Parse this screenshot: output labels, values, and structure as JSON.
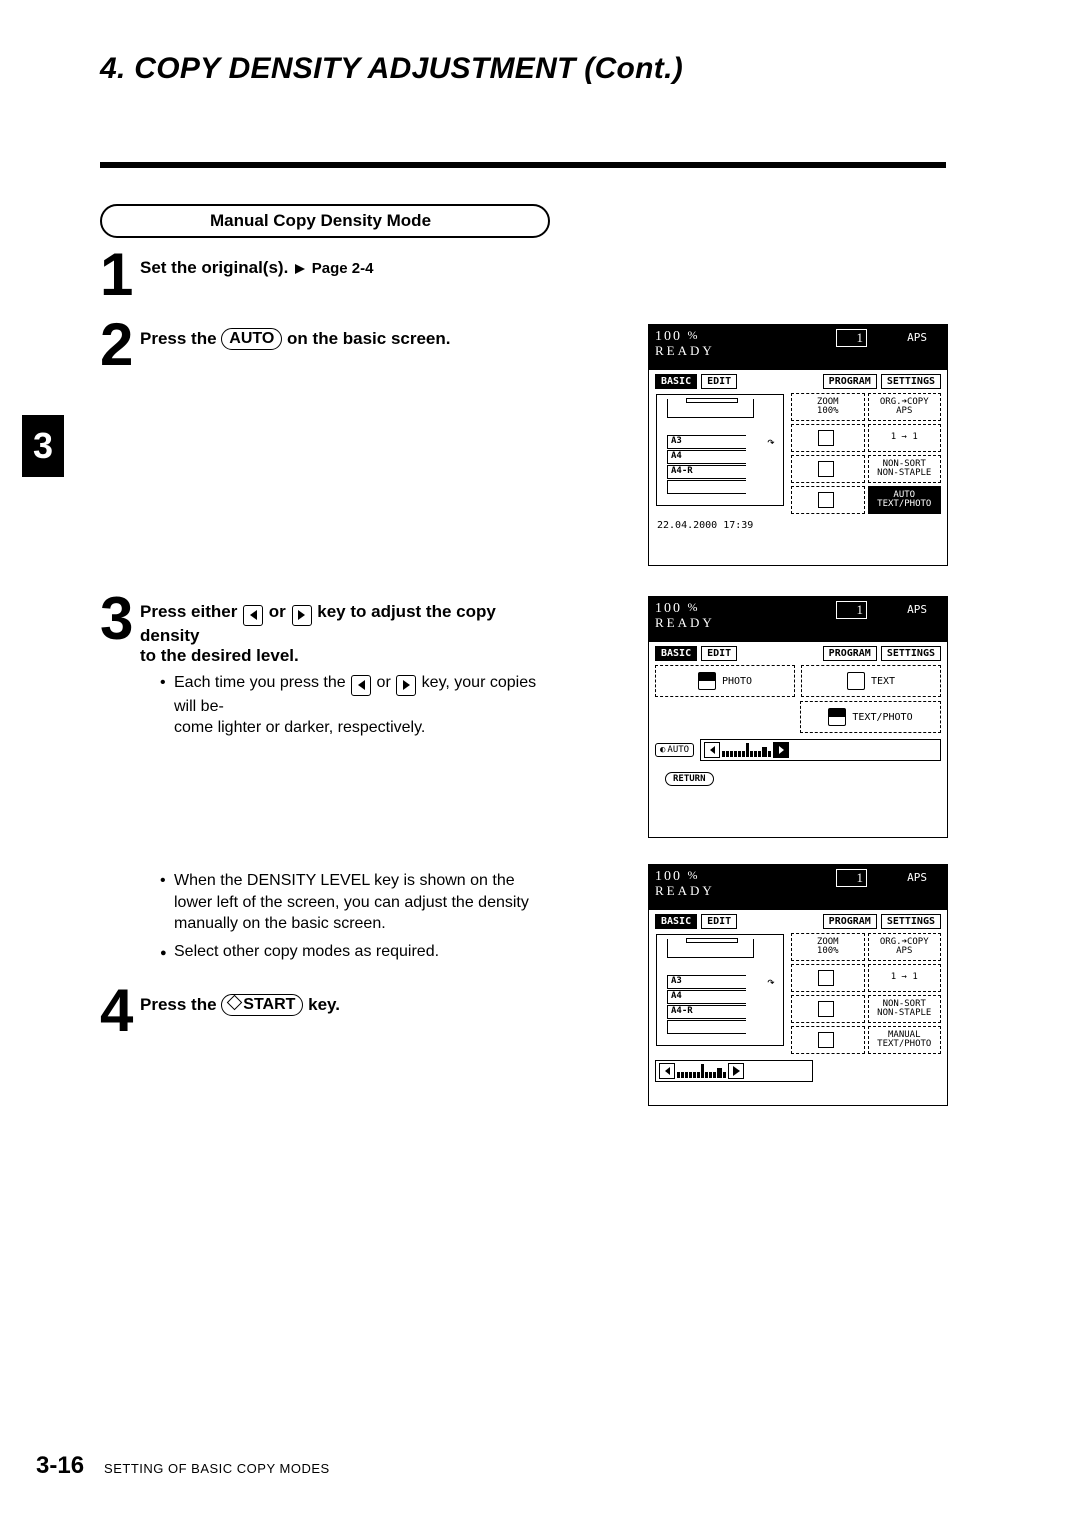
{
  "header": {
    "title": "4. COPY DENSITY ADJUSTMENT (Cont.)"
  },
  "section_pill": "Manual Copy Density Mode",
  "chapter_tab": "3",
  "steps": {
    "s1": {
      "num": "1",
      "line": "Set the original(s).",
      "page_ref": "Page 2-4"
    },
    "s2": {
      "num": "2",
      "pre": "Press the ",
      "key": "AUTO",
      "post": " on the basic screen."
    },
    "s3": {
      "num": "3",
      "line_a": "Press either ",
      "line_mid": " or ",
      "line_b": " key to adjust the copy density",
      "line_c": "to the desired level.",
      "bullet1_a": "Each time you press the ",
      "bullet1_b": " or ",
      "bullet1_c": " key, your copies will be-",
      "bullet1_d": "come lighter or darker, respectively.",
      "bullet2": "When the DENSITY LEVEL key is shown on the lower left of the screen, you can adjust the density manually on the basic screen.",
      "bullet3": "Select other copy modes as required."
    },
    "s4": {
      "num": "4",
      "pre": "Press the ",
      "key": "START",
      "post": " key."
    }
  },
  "lcd_common": {
    "zoom": "100",
    "percent": "%",
    "ready": "READY",
    "qty": "1",
    "aps": "APS",
    "tabs": {
      "basic": "BASIC",
      "edit": "EDIT",
      "program": "PROGRAM",
      "settings": "SETTINGS"
    }
  },
  "lcd1": {
    "right": {
      "zoom": "ZOOM\n100%",
      "org": "ORG.➜COPY\nAPS",
      "dup": "1 → 1",
      "sort": "NON-SORT\nNON-STAPLE",
      "dens": "AUTO\nTEXT/PHOTO"
    },
    "trays": {
      "a3": "A3",
      "a4": "A4",
      "a4r": "A4-R"
    },
    "timestamp": "22.04.2000 17:39"
  },
  "lcd2": {
    "modes": {
      "photo": "PHOTO",
      "text": "TEXT",
      "textphoto": "TEXT/PHOTO"
    },
    "auto": "AUTO",
    "return": "RETURN"
  },
  "lcd3": {
    "right": {
      "zoom": "ZOOM\n100%",
      "org": "ORG.➜COPY\nAPS",
      "dup": "1 → 1",
      "sort": "NON-SORT\nNON-STAPLE",
      "dens": "MANUAL\nTEXT/PHOTO"
    },
    "trays": {
      "a3": "A3",
      "a4": "A4",
      "a4r": "A4-R"
    }
  },
  "footer": {
    "page": "3-16",
    "section": "SETTING OF BASIC COPY MODES"
  }
}
